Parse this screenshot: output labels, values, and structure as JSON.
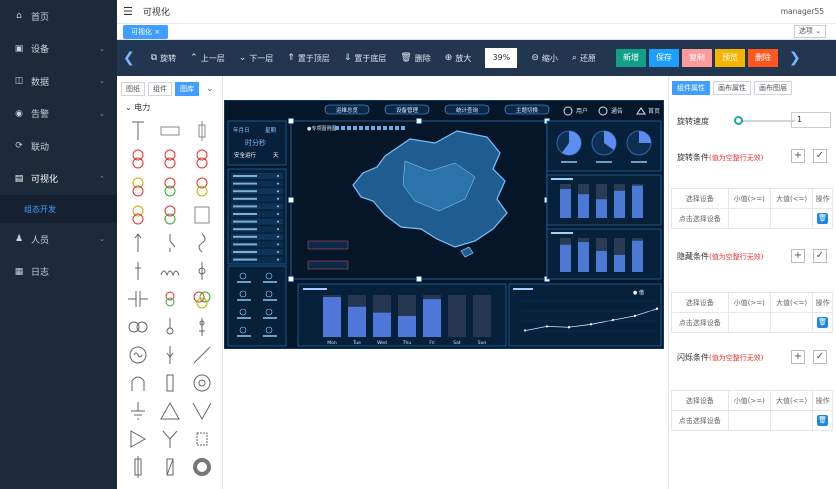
{
  "sidebar": {
    "items": [
      {
        "label": "首页",
        "icon": "home-icon"
      },
      {
        "label": "设备",
        "icon": "device-icon",
        "chev": "⌄"
      },
      {
        "label": "数据",
        "icon": "data-icon",
        "chev": "⌄"
      },
      {
        "label": "告警",
        "icon": "alert-icon",
        "chev": "⌄"
      },
      {
        "label": "联动",
        "icon": "link-icon"
      },
      {
        "label": "可视化",
        "icon": "visual-icon",
        "chev": "⌃"
      },
      {
        "label": "组态开发",
        "sub": true
      },
      {
        "label": "人员",
        "icon": "user-icon",
        "chev": "⌄"
      },
      {
        "label": "日志",
        "icon": "log-icon"
      }
    ]
  },
  "header": {
    "title": "可视化",
    "user": "manager55"
  },
  "tabs": {
    "active": "可视化 ×",
    "option": "选项 ⌄"
  },
  "toolbar": {
    "rotate": "旋转",
    "up": "上一层",
    "down": "下一层",
    "top": "置于顶层",
    "bottom": "置于底层",
    "delete": "删除",
    "zoom_in": "放大",
    "zoom_value": "39%",
    "zoom_out": "缩小",
    "reset": "还原",
    "btn_new": "新增",
    "btn_save": "保存",
    "btn_copy": "复制",
    "btn_preview": "预览",
    "btn_remove": "删除"
  },
  "left": {
    "seg1": "图纸",
    "seg2": "组件",
    "seg3": "图库",
    "category": "电力"
  },
  "right": {
    "tab1": "组件属性",
    "tab2": "画布属性",
    "tab3": "画布图层",
    "speed_label": "旋转速度",
    "speed_value": "1",
    "rotate_cond": "旋转条件",
    "hide_cond": "隐藏条件",
    "blink_cond": "闪烁条件",
    "blank_hint": "(值为空整行无效)",
    "col_device": "选择设备",
    "col_min": "小值(>=)",
    "col_max": "大值(<=)",
    "col_op": "操作",
    "pick_device": "点击选择设备"
  },
  "dashboard": {
    "nav": [
      "运维总览",
      "设备管理",
      "统计查询",
      "主题切换"
    ],
    "user": "用户",
    "notify": "通告",
    "home": "首页",
    "left_title": "年月日",
    "left_sub": "星期",
    "time": "时分秒",
    "safe": "安全运行",
    "days": "天",
    "map_title": "●专项图例图",
    "bar_days": [
      "Mon",
      "Tue",
      "Wed",
      "Thu",
      "Fri",
      "Sat",
      "Sun"
    ],
    "bar_vals": [
      95,
      72,
      58,
      50,
      90,
      0,
      0
    ],
    "line_vals": [
      20,
      30,
      28,
      35,
      45,
      55,
      72
    ],
    "legend": "● 值",
    "gauge_vals": [
      0.6,
      0.35,
      0.25
    ],
    "mini_bar1": [
      85,
      70,
      55,
      80,
      95
    ],
    "mini_bar2": [
      80,
      88,
      62,
      50,
      92
    ]
  }
}
